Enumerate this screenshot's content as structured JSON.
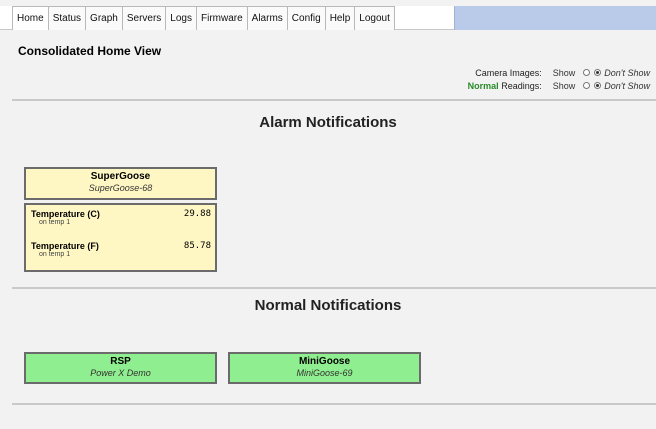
{
  "nav": {
    "tabs": [
      "Home",
      "Status",
      "Graph",
      "Servers",
      "Logs",
      "Firmware",
      "Alarms",
      "Config",
      "Help",
      "Logout"
    ]
  },
  "page_title": "Consolidated Home View",
  "options": {
    "camera_label": "Camera Images:",
    "normal_word": "Normal",
    "readings_label": "Readings:",
    "show": "Show",
    "dont_show": "Don't Show"
  },
  "alarm": {
    "heading": "Alarm Notifications",
    "device": {
      "name": "SuperGoose",
      "sub": "SuperGoose-68"
    },
    "readings": [
      {
        "label": "Temperature (C)",
        "sub": "on temp 1",
        "value": "29.88"
      },
      {
        "label": "Temperature (F)",
        "sub": "on temp 1",
        "value": "85.78"
      }
    ]
  },
  "normal": {
    "heading": "Normal Notifications",
    "devices": [
      {
        "name": "RSP",
        "sub": "Power X Demo"
      },
      {
        "name": "MiniGoose",
        "sub": "MiniGoose-69"
      }
    ]
  },
  "colors": {
    "alarm_bg": "#fef7c4",
    "normal_bg": "#8fee8f",
    "nav_fill": "#b9cbe8",
    "normal_word": "#2a8a2a"
  }
}
